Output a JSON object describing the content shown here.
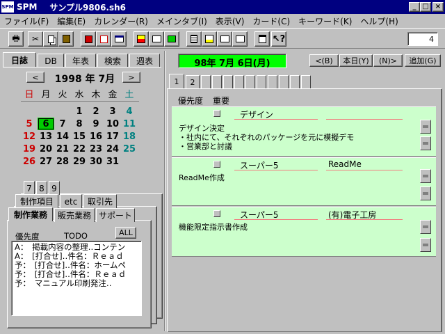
{
  "window": {
    "app": "SPM",
    "file": "サンプル9806.sh6",
    "logo": "SPM"
  },
  "window_buttons": {
    "minimize": "_",
    "maximize": "□",
    "close": "×"
  },
  "menu": [
    "ファイル(F)",
    "編集(E)",
    "カレンダー(R)",
    "メインタブ(I)",
    "表示(V)",
    "カード(C)",
    "キーワード(K)",
    "ヘルプ(H)"
  ],
  "toolbar": {
    "counter": "4",
    "icons": [
      "printer-icon",
      "cut-icon",
      "copy-icon",
      "paste-icon",
      "copy-card-icon",
      "paste-card-icon",
      "window-icon",
      "color-red-icon",
      "cascade-icon",
      "color-green-icon",
      "list-icon",
      "notes-icon",
      "folder-icon",
      "folder-open-icon",
      "page-icon",
      "help-icon"
    ]
  },
  "left_tabs": [
    "日誌",
    "DB",
    "年表",
    "検索",
    "週表"
  ],
  "calendar": {
    "prev": "<",
    "next": ">",
    "month_label": "1998 年 7月",
    "weekdays": [
      "日",
      "月",
      "火",
      "水",
      "木",
      "金",
      "土"
    ],
    "weeks": [
      [
        "",
        "",
        "",
        "1",
        "2",
        "3",
        "4"
      ],
      [
        "5",
        "6",
        "7",
        "8",
        "9",
        "10",
        "11"
      ],
      [
        "12",
        "13",
        "14",
        "15",
        "16",
        "17",
        "18"
      ],
      [
        "19",
        "20",
        "21",
        "22",
        "23",
        "24",
        "25"
      ],
      [
        "26",
        "27",
        "28",
        "29",
        "30",
        "31",
        ""
      ]
    ],
    "selected": "6",
    "colors": {
      "sunday": "#cc0000",
      "saturday": "#008080",
      "weekday": "#000000",
      "selected_bg": "#00cc00"
    }
  },
  "num_tabs": [
    "7",
    "8",
    "9"
  ],
  "category_tabs": [
    "制作項目",
    "etc",
    "取引先"
  ],
  "work_tabs": [
    "制作業務",
    "販売業務",
    "サポート"
  ],
  "todo": {
    "priority_label": "優先度",
    "todo_label": "TODO",
    "all_button": "ALL",
    "items": [
      "A：　掲載内容の整理‥コンテン",
      "A：　[打合せ]‥件名：Ｒｅａｄ",
      "予：　[打合せ]‥件名：ホームペ",
      "予：　[打合せ]‥件名：Ｒｅａｄ",
      "予：　マニュアル印刷発注‥"
    ]
  },
  "date_display": "98年 7月 6日(月)",
  "nav": {
    "prev": "<(B)",
    "today": "本日(Y)",
    "next": "(N)>",
    "add": "追加(G)"
  },
  "page_tabs": [
    "1",
    "2"
  ],
  "columns": {
    "priority": "優先度",
    "importance": "重要"
  },
  "notes": [
    {
      "title": "デザイン",
      "keyword": "",
      "lines": [
        "デザイン決定",
        "・社内にて、それぞれのパッケージを元に模擬デモ",
        "・営業部と討議"
      ]
    },
    {
      "title": "スーパー5",
      "keyword": "ReadMe",
      "lines": [
        "ReadMe作成"
      ]
    },
    {
      "title": "スーパー5",
      "keyword": "(有)電子工房",
      "lines": [
        "機能限定指示書作成"
      ]
    }
  ],
  "colors": {
    "titlebar": "#000080",
    "note_bg": "#ccffcc",
    "date_bg": "#00ff00"
  }
}
